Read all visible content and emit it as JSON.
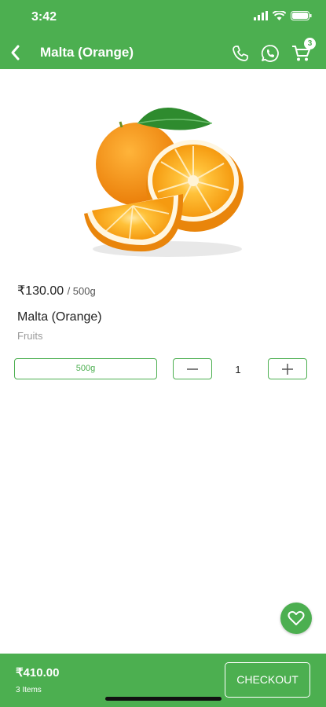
{
  "status_bar": {
    "time": "3:42"
  },
  "header": {
    "title": "Malta (Orange)",
    "cart_count": "3",
    "icons": [
      "back-icon",
      "phone-icon",
      "whatsapp-icon",
      "cart-icon"
    ]
  },
  "product": {
    "price": "₹130.00",
    "unit": "/ 500g",
    "name": "Malta (Orange)",
    "category": "Fruits",
    "weight_option": "500g",
    "quantity": "1"
  },
  "footer": {
    "total": "₹410.00",
    "items": "3 Items",
    "checkout_label": "CHECKOUT"
  },
  "colors": {
    "accent": "#4caf50",
    "orange": "#f39a12"
  }
}
